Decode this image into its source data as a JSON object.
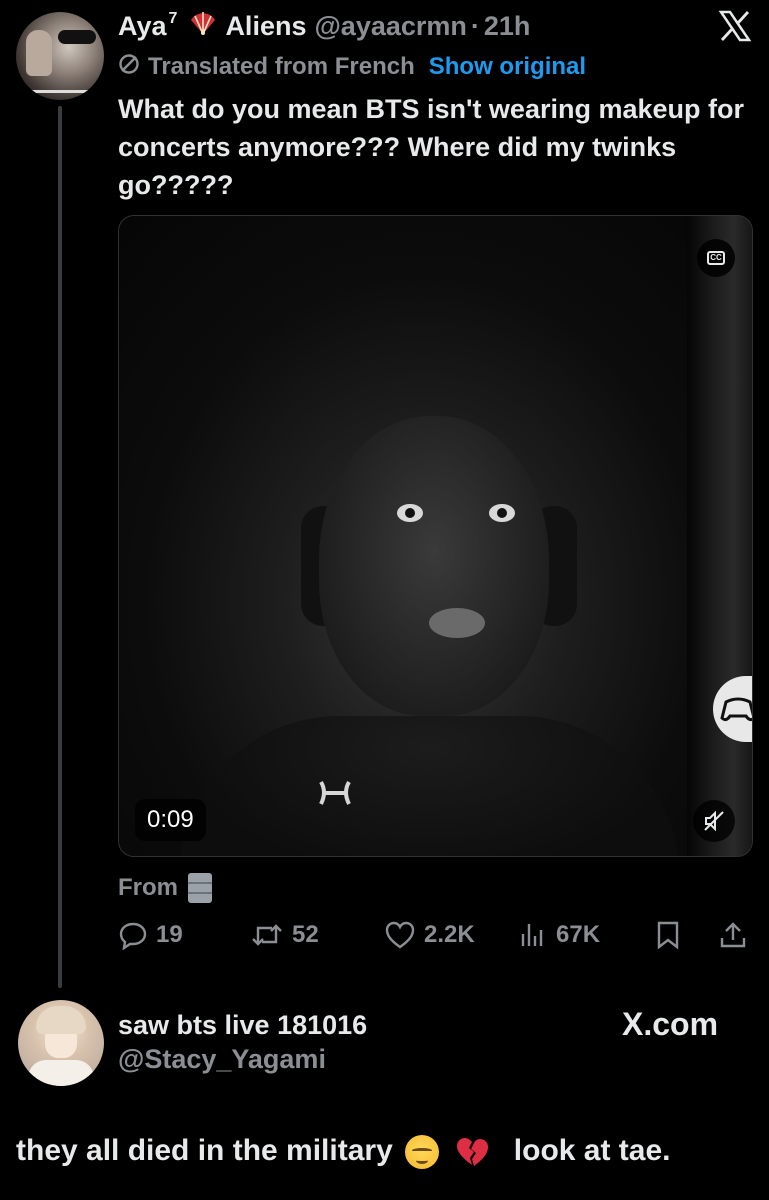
{
  "tweet": {
    "author_name": "Aya",
    "author_superscript": "7",
    "author_org": "Aliens",
    "author_handle": "@ayaacrmn",
    "separator": "·",
    "time": "21h",
    "translated_label": "Translated from French",
    "show_original_label": "Show original",
    "text": "What do you mean BTS isn't wearing makeup for concerts anymore??? Where did my twinks go?????",
    "video": {
      "duration": "0:09",
      "cc_label": "CC"
    },
    "from_label": "From",
    "stats": {
      "replies": "19",
      "reposts": "52",
      "likes": "2.2K",
      "views": "67K"
    }
  },
  "reply": {
    "author_name": "saw bts live 181016",
    "author_handle": "@Stacy_Yagami",
    "site_label": "X.com",
    "text_part1": "they all died in the military",
    "text_part2": "look at tae."
  },
  "icons": {
    "top_right": "x-logo-icon",
    "translate": "ban-icon",
    "reply": "speech-bubble-icon",
    "repost": "repost-arrows-icon",
    "like": "heart-icon",
    "views": "bar-chart-icon",
    "bookmark": "bookmark-icon",
    "share": "share-upload-icon",
    "mute": "muted-speaker-icon",
    "cc": "closed-captions-icon",
    "from": "file-cabinet-emoji",
    "emoji1": "pensive-face-emoji",
    "emoji2": "broken-heart-emoji"
  },
  "colors": {
    "background": "#000000",
    "text_primary": "#e7e9ea",
    "text_secondary": "#8b8f93",
    "accent_link": "#1d9bf0"
  }
}
